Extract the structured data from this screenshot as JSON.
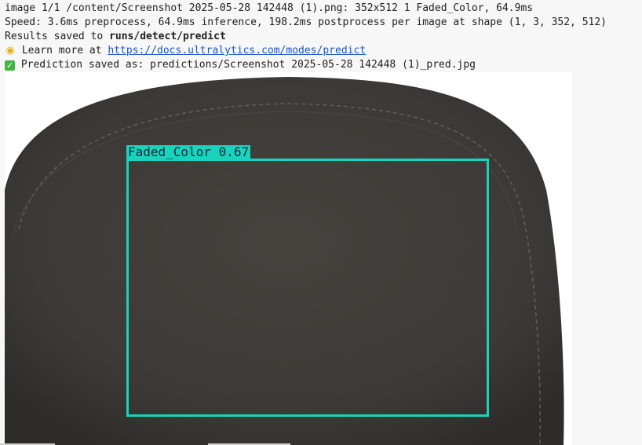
{
  "console": {
    "line1": "image 1/1 /content/Screenshot 2025-05-28 142448 (1).png: 352x512 1 Faded_Color, 64.9ms",
    "line2": "Speed: 3.6ms preprocess, 64.9ms inference, 198.2ms postprocess per image at shape (1, 3, 352, 512)",
    "line3_prefix": "Results saved to ",
    "line3_path": "runs/detect/predict",
    "line4_prefix": " Learn more at ",
    "line4_link": "https://docs.ultralytics.com/modes/predict",
    "line4_icon": "lightbulb-icon",
    "line5_text": " Prediction saved as: predictions/Screenshot 2025-05-28 142448 (1)_pred.jpg",
    "line5_icon": "check-mark-icon"
  },
  "detection": {
    "class_name": "Faded_Color",
    "confidence": "0.67",
    "label": "Faded_Color 0.67",
    "box_color": "#19d3bd"
  },
  "colors": {
    "fabric": "#3d3a37",
    "link": "#1a56c9",
    "check": "#41b543"
  }
}
